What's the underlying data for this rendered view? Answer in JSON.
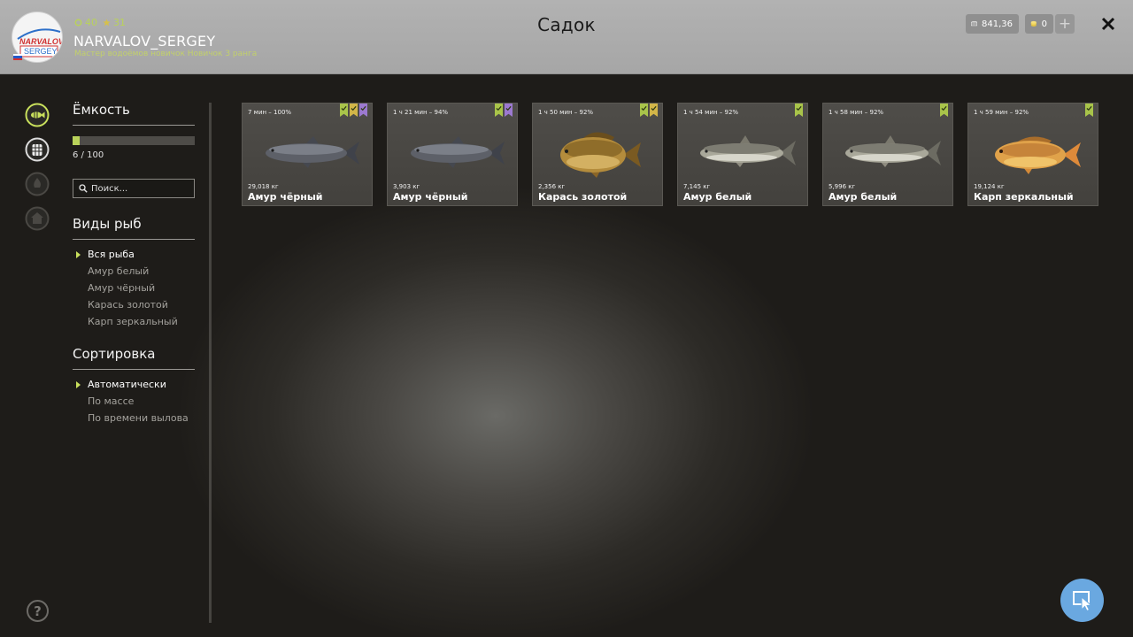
{
  "header": {
    "title": "Садок",
    "player": {
      "name": "NARVALOV_SERGEY",
      "rank_text": "Мастер водоёмов новичок Новичок 3 ранга",
      "level": "40",
      "stars": "31",
      "avatar_text_top": "NARVALOV",
      "avatar_text_bottom": "SERGEY",
      "flag_colors": [
        "#ffffff",
        "#2458c8",
        "#d43030"
      ]
    },
    "currency": {
      "silver": "841,36",
      "gold": "0",
      "add_label": "+"
    },
    "close_icon": "close-icon"
  },
  "rail": [
    {
      "name": "keepnet-fish-icon",
      "active": true
    },
    {
      "name": "keepnet-icon",
      "active": false
    },
    {
      "name": "campfire-icon",
      "disabled": true
    },
    {
      "name": "home-icon",
      "disabled": true
    }
  ],
  "sidebar": {
    "capacity": {
      "title": "Ёмкость",
      "current": 6,
      "max": 100,
      "text": "6 / 100",
      "fill_fraction": 0.06
    },
    "search": {
      "placeholder": "Поиск..."
    },
    "species": {
      "title": "Виды рыб",
      "items": [
        "Вся рыба",
        "Амур белый",
        "Амур чёрный",
        "Карась золотой",
        "Карп зеркальный"
      ],
      "active_index": 0
    },
    "sort": {
      "title": "Сортировка",
      "items": [
        "Автоматически",
        "По массе",
        "По времени вылова"
      ],
      "active_index": 0
    }
  },
  "fish": [
    {
      "time": "7 мин – 100%",
      "weight": "29,018 кг",
      "name": "Амур чёрный",
      "badges": [
        "g",
        "y",
        "p"
      ],
      "kind": "black-amur"
    },
    {
      "time": "1 ч 21 мин – 94%",
      "weight": "3,903 кг",
      "name": "Амур чёрный",
      "badges": [
        "g",
        "p"
      ],
      "kind": "black-amur"
    },
    {
      "time": "1 ч 50 мин – 92%",
      "weight": "2,356 кг",
      "name": "Карась золотой",
      "badges": [
        "g",
        "y"
      ],
      "kind": "crucian"
    },
    {
      "time": "1 ч 54 мин – 92%",
      "weight": "7,145 кг",
      "name": "Амур белый",
      "badges": [
        "g"
      ],
      "kind": "white-amur"
    },
    {
      "time": "1 ч 58 мин – 92%",
      "weight": "5,996 кг",
      "name": "Амур белый",
      "badges": [
        "g"
      ],
      "kind": "white-amur"
    },
    {
      "time": "1 ч 59 мин – 92%",
      "weight": "19,124 кг",
      "name": "Карп зеркальный",
      "badges": [
        "g"
      ],
      "kind": "mirror-carp"
    }
  ],
  "colors": {
    "accent": "#b9d25a",
    "header_bg": "#aaaaaa",
    "cursor_button": "#6aa8e0"
  }
}
